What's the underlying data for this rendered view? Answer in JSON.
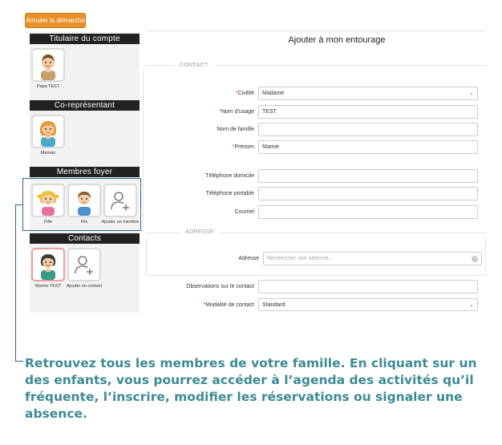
{
  "toolbar": {
    "cancel_label": "Annuler la démarche"
  },
  "sidebar": {
    "titulaire": {
      "heading": "Titulaire du compte",
      "members": [
        {
          "name": "Papa TEST"
        }
      ]
    },
    "corep": {
      "heading": "Co-représentant",
      "members": [
        {
          "name": "Maman"
        }
      ]
    },
    "foyer": {
      "heading": "Membres foyer",
      "members": [
        {
          "name": "Fille"
        },
        {
          "name": "Fils"
        }
      ],
      "add_label": "Ajouter un membre"
    },
    "contacts": {
      "heading": "Contacts",
      "members": [
        {
          "name": "Mamie TEST"
        }
      ],
      "add_label": "Ajouter un contact"
    }
  },
  "form": {
    "title": "Ajouter à mon entourage",
    "sections": {
      "contact": "CONTACT",
      "adresse": "ADRESSE"
    },
    "fields": {
      "civilite": {
        "label": "Civilité",
        "value": "Madame",
        "required": true
      },
      "nom_usage": {
        "label": "Nom d'usage",
        "value": "TEST",
        "required": true
      },
      "nom_famille": {
        "label": "Nom de famille",
        "value": "",
        "required": false
      },
      "prenom": {
        "label": "Prénom",
        "value": "Mamie",
        "required": true
      },
      "tel_domicile": {
        "label": "Téléphone domicile",
        "value": "",
        "required": false
      },
      "tel_portable": {
        "label": "Téléphone portable",
        "value": "",
        "required": false
      },
      "courriel": {
        "label": "Courriel",
        "value": "",
        "required": false
      },
      "adresse": {
        "label": "Adresse",
        "placeholder": "Rechercher une adresse..."
      },
      "observations": {
        "label": "Observations sur le contact",
        "value": ""
      },
      "modalite": {
        "label": "Modalité de contact",
        "value": "Standard",
        "required": true
      }
    },
    "required_marker": "*"
  },
  "callout": {
    "text": "Retrouvez tous les membres de votre famille. En cliquant sur un des enfants, vous pourrez accéder à l’agenda des activités qu’il fréquente, l’inscrire, modifier les réservations ou signaler une absence."
  },
  "colors": {
    "accent": "#e8912a",
    "callout": "#3d8a95",
    "required": "#c0392b"
  }
}
